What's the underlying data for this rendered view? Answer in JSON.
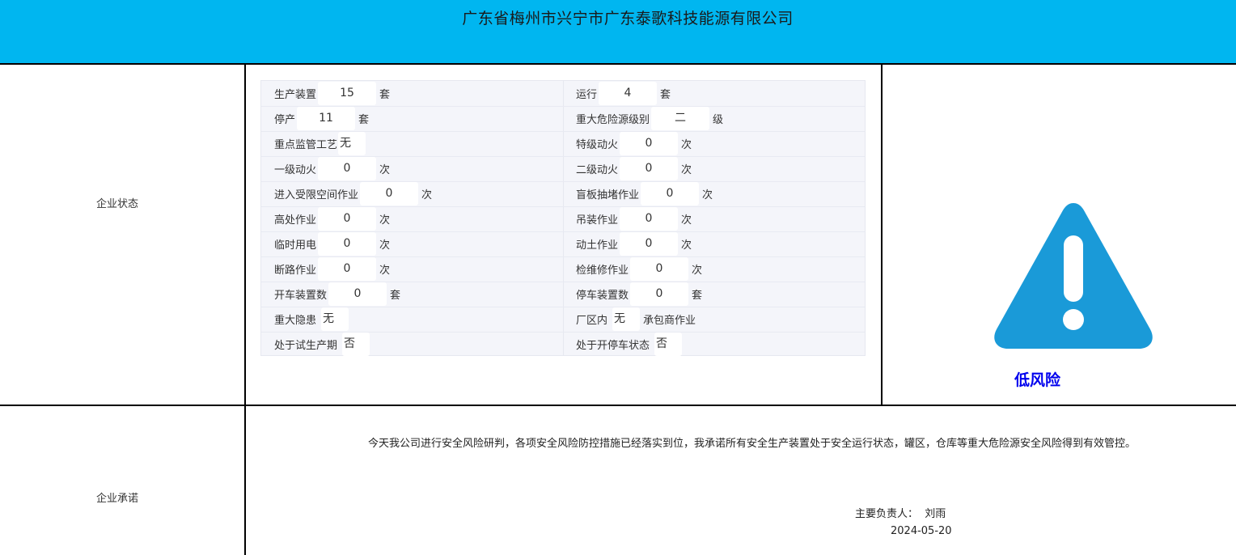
{
  "header": {
    "title": "广东省梅州市兴宁市广东泰歌科技能源有限公司"
  },
  "sections": {
    "status_label": "企业状态",
    "promise_label": "企业承诺"
  },
  "form": {
    "production_units": {
      "label": "生产装置",
      "value": "15",
      "unit": "套"
    },
    "running": {
      "label": "运行",
      "value": "4",
      "unit": "套"
    },
    "stopped": {
      "label": "停产",
      "value": "11",
      "unit": "套"
    },
    "major_hazard_level": {
      "label": "重大危险源级别",
      "value": "二",
      "unit": "级"
    },
    "key_process": {
      "label": "重点监管工艺",
      "value": "无"
    },
    "special_hot_work": {
      "label": "特级动火",
      "value": "0",
      "unit": "次"
    },
    "level1_hot_work": {
      "label": "一级动火",
      "value": "0",
      "unit": "次"
    },
    "level2_hot_work": {
      "label": "二级动火",
      "value": "0",
      "unit": "次"
    },
    "confined_space": {
      "label": "进入受限空间作业",
      "value": "0",
      "unit": "次"
    },
    "blind_plate": {
      "label": "盲板抽堵作业",
      "value": "0",
      "unit": "次"
    },
    "height_work": {
      "label": "高处作业",
      "value": "0",
      "unit": "次"
    },
    "lifting": {
      "label": "吊装作业",
      "value": "0",
      "unit": "次"
    },
    "temp_power": {
      "label": "临时用电",
      "value": "0",
      "unit": "次"
    },
    "earthwork": {
      "label": "动土作业",
      "value": "0",
      "unit": "次"
    },
    "road_break": {
      "label": "断路作业",
      "value": "0",
      "unit": "次"
    },
    "maintenance": {
      "label": "检维修作业",
      "value": "0",
      "unit": "次"
    },
    "start_units": {
      "label": "开车装置数",
      "value": "0",
      "unit": "套"
    },
    "stop_units": {
      "label": "停车装置数",
      "value": "0",
      "unit": "套"
    },
    "major_hazard": {
      "label": "重大隐患",
      "value": "无"
    },
    "in_plant": {
      "label": "厂区内",
      "value": "无",
      "suffix": "承包商作业"
    },
    "trial_production": {
      "label": "处于试生产期",
      "value": "否"
    },
    "start_stop_state": {
      "label": "处于开停车状态",
      "value": "否"
    }
  },
  "risk": {
    "icon": "warning-triangle-icon",
    "color": "#1a9ad8",
    "label": "低风险",
    "label_color": "#0000ee"
  },
  "promise": {
    "text": "今天我公司进行安全风险研判，各项安全风险防控措施已经落实到位，我承诺所有安全生产装置处于安全运行状态，罐区，仓库等重大危险源安全风险得到有效管控。",
    "signer_label": "主要负责人：  刘雨",
    "date": "2024-05-20"
  }
}
